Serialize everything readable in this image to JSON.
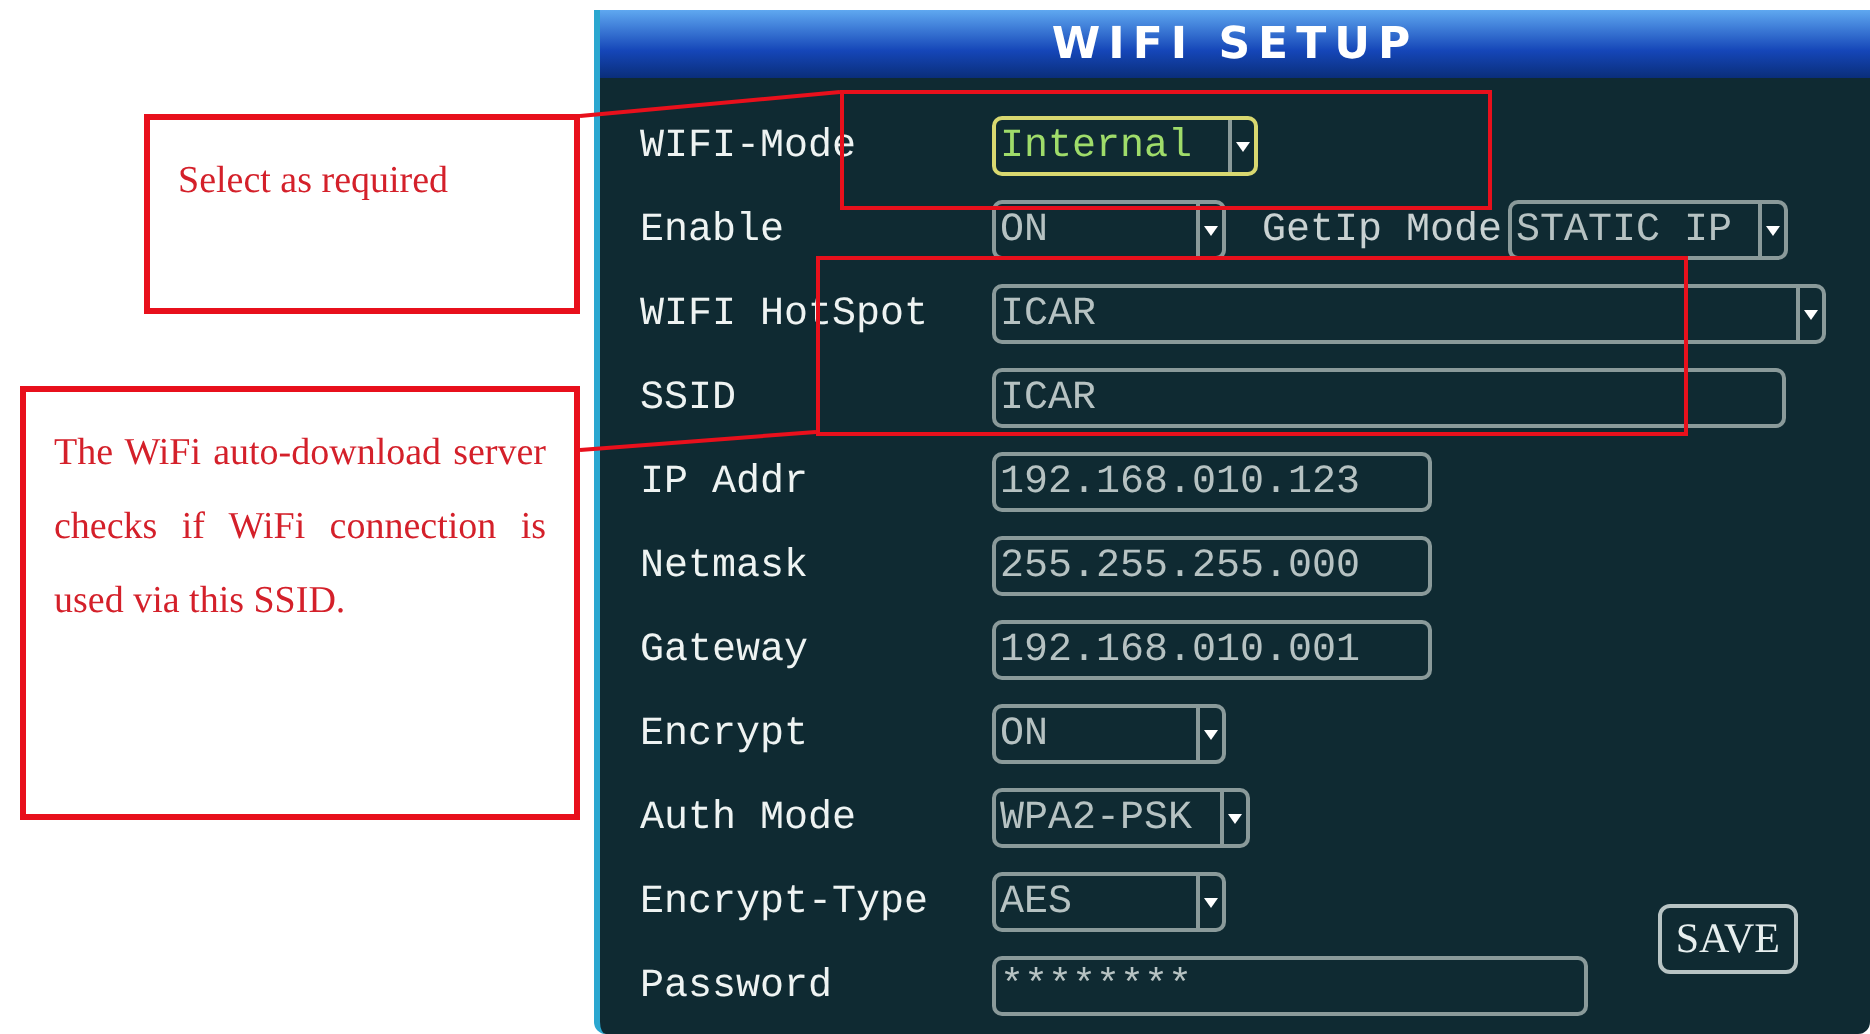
{
  "annotations": [
    {
      "text": "Select as required"
    },
    {
      "text": "The WiFi auto-download server checks if WiFi connection is used via this SSID."
    }
  ],
  "panel": {
    "title": "WIFI SETUP",
    "rows": [
      {
        "label": "WIFI-Mode",
        "kind": "dropdown",
        "value": "Internal",
        "focused": true
      },
      {
        "label": "Enable",
        "kind": "dropdown",
        "value": "ON",
        "focused": false,
        "extra": {
          "label": "GetIp Mode",
          "value": "STATIC IP",
          "focused": false
        }
      },
      {
        "label": "WIFI HotSpot",
        "kind": "dropdown",
        "value": "ICAR",
        "focused": false
      },
      {
        "label": "SSID",
        "kind": "text",
        "value": "ICAR",
        "focused": false
      },
      {
        "label": "IP Addr",
        "kind": "text",
        "value": "192.168.010.123",
        "focused": false
      },
      {
        "label": "Netmask",
        "kind": "text",
        "value": "255.255.255.000",
        "focused": false
      },
      {
        "label": "Gateway",
        "kind": "text",
        "value": "192.168.010.001",
        "focused": false
      },
      {
        "label": "Encrypt",
        "kind": "dropdown",
        "value": "ON",
        "focused": false
      },
      {
        "label": "Auth Mode",
        "kind": "dropdown",
        "value": "WPA2-PSK",
        "focused": false
      },
      {
        "label": "Encrypt-Type",
        "kind": "dropdown",
        "value": "AES",
        "focused": false
      },
      {
        "label": "Password",
        "kind": "text",
        "value": "********",
        "focused": false
      }
    ],
    "save_button": "SAVE"
  }
}
